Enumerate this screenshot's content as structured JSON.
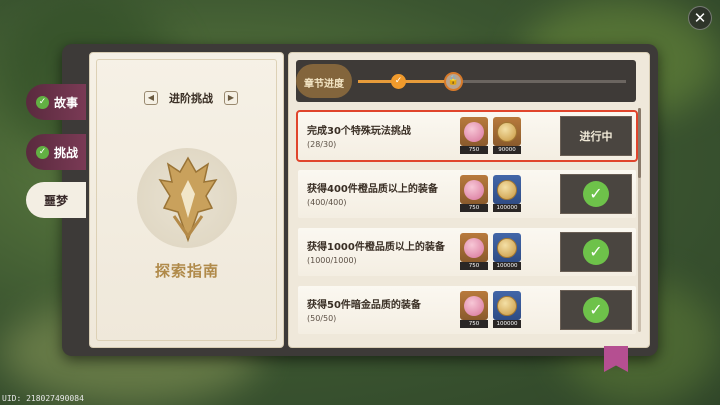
{
  "tabs": [
    {
      "label": "故事",
      "completed": true
    },
    {
      "label": "挑战",
      "completed": true
    },
    {
      "label": "噩梦",
      "completed": false,
      "active": true
    }
  ],
  "left_page": {
    "subtitle": "进阶挑战",
    "prev_symbol": "◀",
    "next_symbol": "▶",
    "guide_title": "探索指南"
  },
  "chapter_progress": {
    "label": "章节进度",
    "done_symbol": "✓",
    "locked_symbol": "🔒"
  },
  "tasks": [
    {
      "title": "完成30个特殊玩法挑战",
      "progress": "(28/30)",
      "rewards": [
        {
          "icon": "pink-gem-icon",
          "qty": "750"
        },
        {
          "icon": "gold-coin-icon",
          "qty": "90000"
        }
      ],
      "status": "进行中",
      "completed": false
    },
    {
      "title": "获得400件橙品质以上的装备",
      "progress": "(400/400)",
      "rewards": [
        {
          "icon": "pink-gem-icon",
          "qty": "750"
        },
        {
          "icon": "gold-coin-icon",
          "qty": "100000"
        }
      ],
      "status": "",
      "completed": true
    },
    {
      "title": "获得1000件橙品质以上的装备",
      "progress": "(1000/1000)",
      "rewards": [
        {
          "icon": "pink-gem-icon",
          "qty": "750"
        },
        {
          "icon": "gold-coin-icon",
          "qty": "100000"
        }
      ],
      "status": "",
      "completed": true
    },
    {
      "title": "获得50件暗金品质的装备",
      "progress": "(50/50)",
      "rewards": [
        {
          "icon": "pink-gem-icon",
          "qty": "750"
        },
        {
          "icon": "gold-coin-icon",
          "qty": "100000"
        }
      ],
      "status": "",
      "completed": true
    }
  ],
  "check_symbol": "✓",
  "close_symbol": "✕",
  "uid": "UID: 218027490084"
}
